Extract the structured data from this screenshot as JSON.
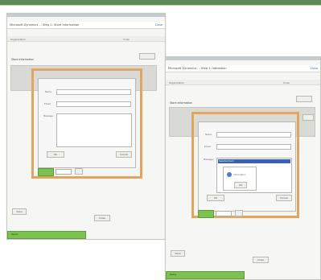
{
  "left_window": {
    "header_title": "Microsoft Dynamics ... Step 1: Store Information",
    "header_link": "Close",
    "sub_left": "Organization",
    "sub_right": "Code",
    "section_label": "Store information",
    "label1": "Name:",
    "label2": "Email:",
    "label3": "Message:",
    "ok_label": "OK",
    "cancel_label": "Cancel",
    "footer_left": "Ready",
    "footer_button": "Save",
    "footer_button2": "Close"
  },
  "right_window": {
    "header_title": "Microsoft Dynamics ... Step 1: Validation",
    "header_link": "Close",
    "sub_left": "Organization",
    "sub_right": "Code",
    "section_label": "Store information",
    "label_a": "Name:",
    "label_b": "Email:",
    "label_c": "Message:",
    "dialog_text": "Information",
    "dialog_ok": "OK",
    "list_selected": "Selected item",
    "ok_label": "OK",
    "cancel_label": "Cancel",
    "footer_left": "Ready",
    "footer_button": "Save",
    "footer_button2": "Close"
  }
}
